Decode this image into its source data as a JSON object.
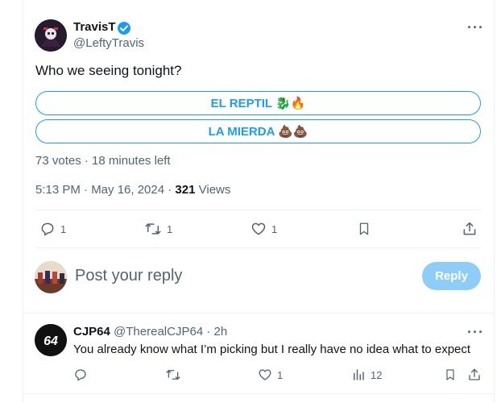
{
  "tweet": {
    "author_name": "TravisT",
    "author_handle": "@LeftyTravis",
    "text": "Who we seeing tonight?",
    "poll_options": [
      {
        "label": "EL REPTIL 🐉🔥"
      },
      {
        "label": "LA MIERDA 💩💩"
      }
    ],
    "poll_summary": "73 votes · 18 minutes left",
    "timestamp": "5:13 PM · May 16, 2024 · ",
    "views_count": "321",
    "views_label": "Views",
    "replies": "1",
    "retweets": "1",
    "likes": "1",
    "more_icon": "more-icon"
  },
  "composer": {
    "placeholder": "Post your reply",
    "button_label": "Reply"
  },
  "reply": {
    "author_name": "CJP64",
    "author_handle": "@TherealCJP64",
    "time": "· 2h",
    "text": "You already know what I’m picking but I really have no idea what to expect",
    "likes": "1",
    "views": "12"
  },
  "colors": {
    "accent": "#1d9bf0",
    "reply_button_disabled": "#8ecdf8",
    "muted_text": "#536471"
  }
}
